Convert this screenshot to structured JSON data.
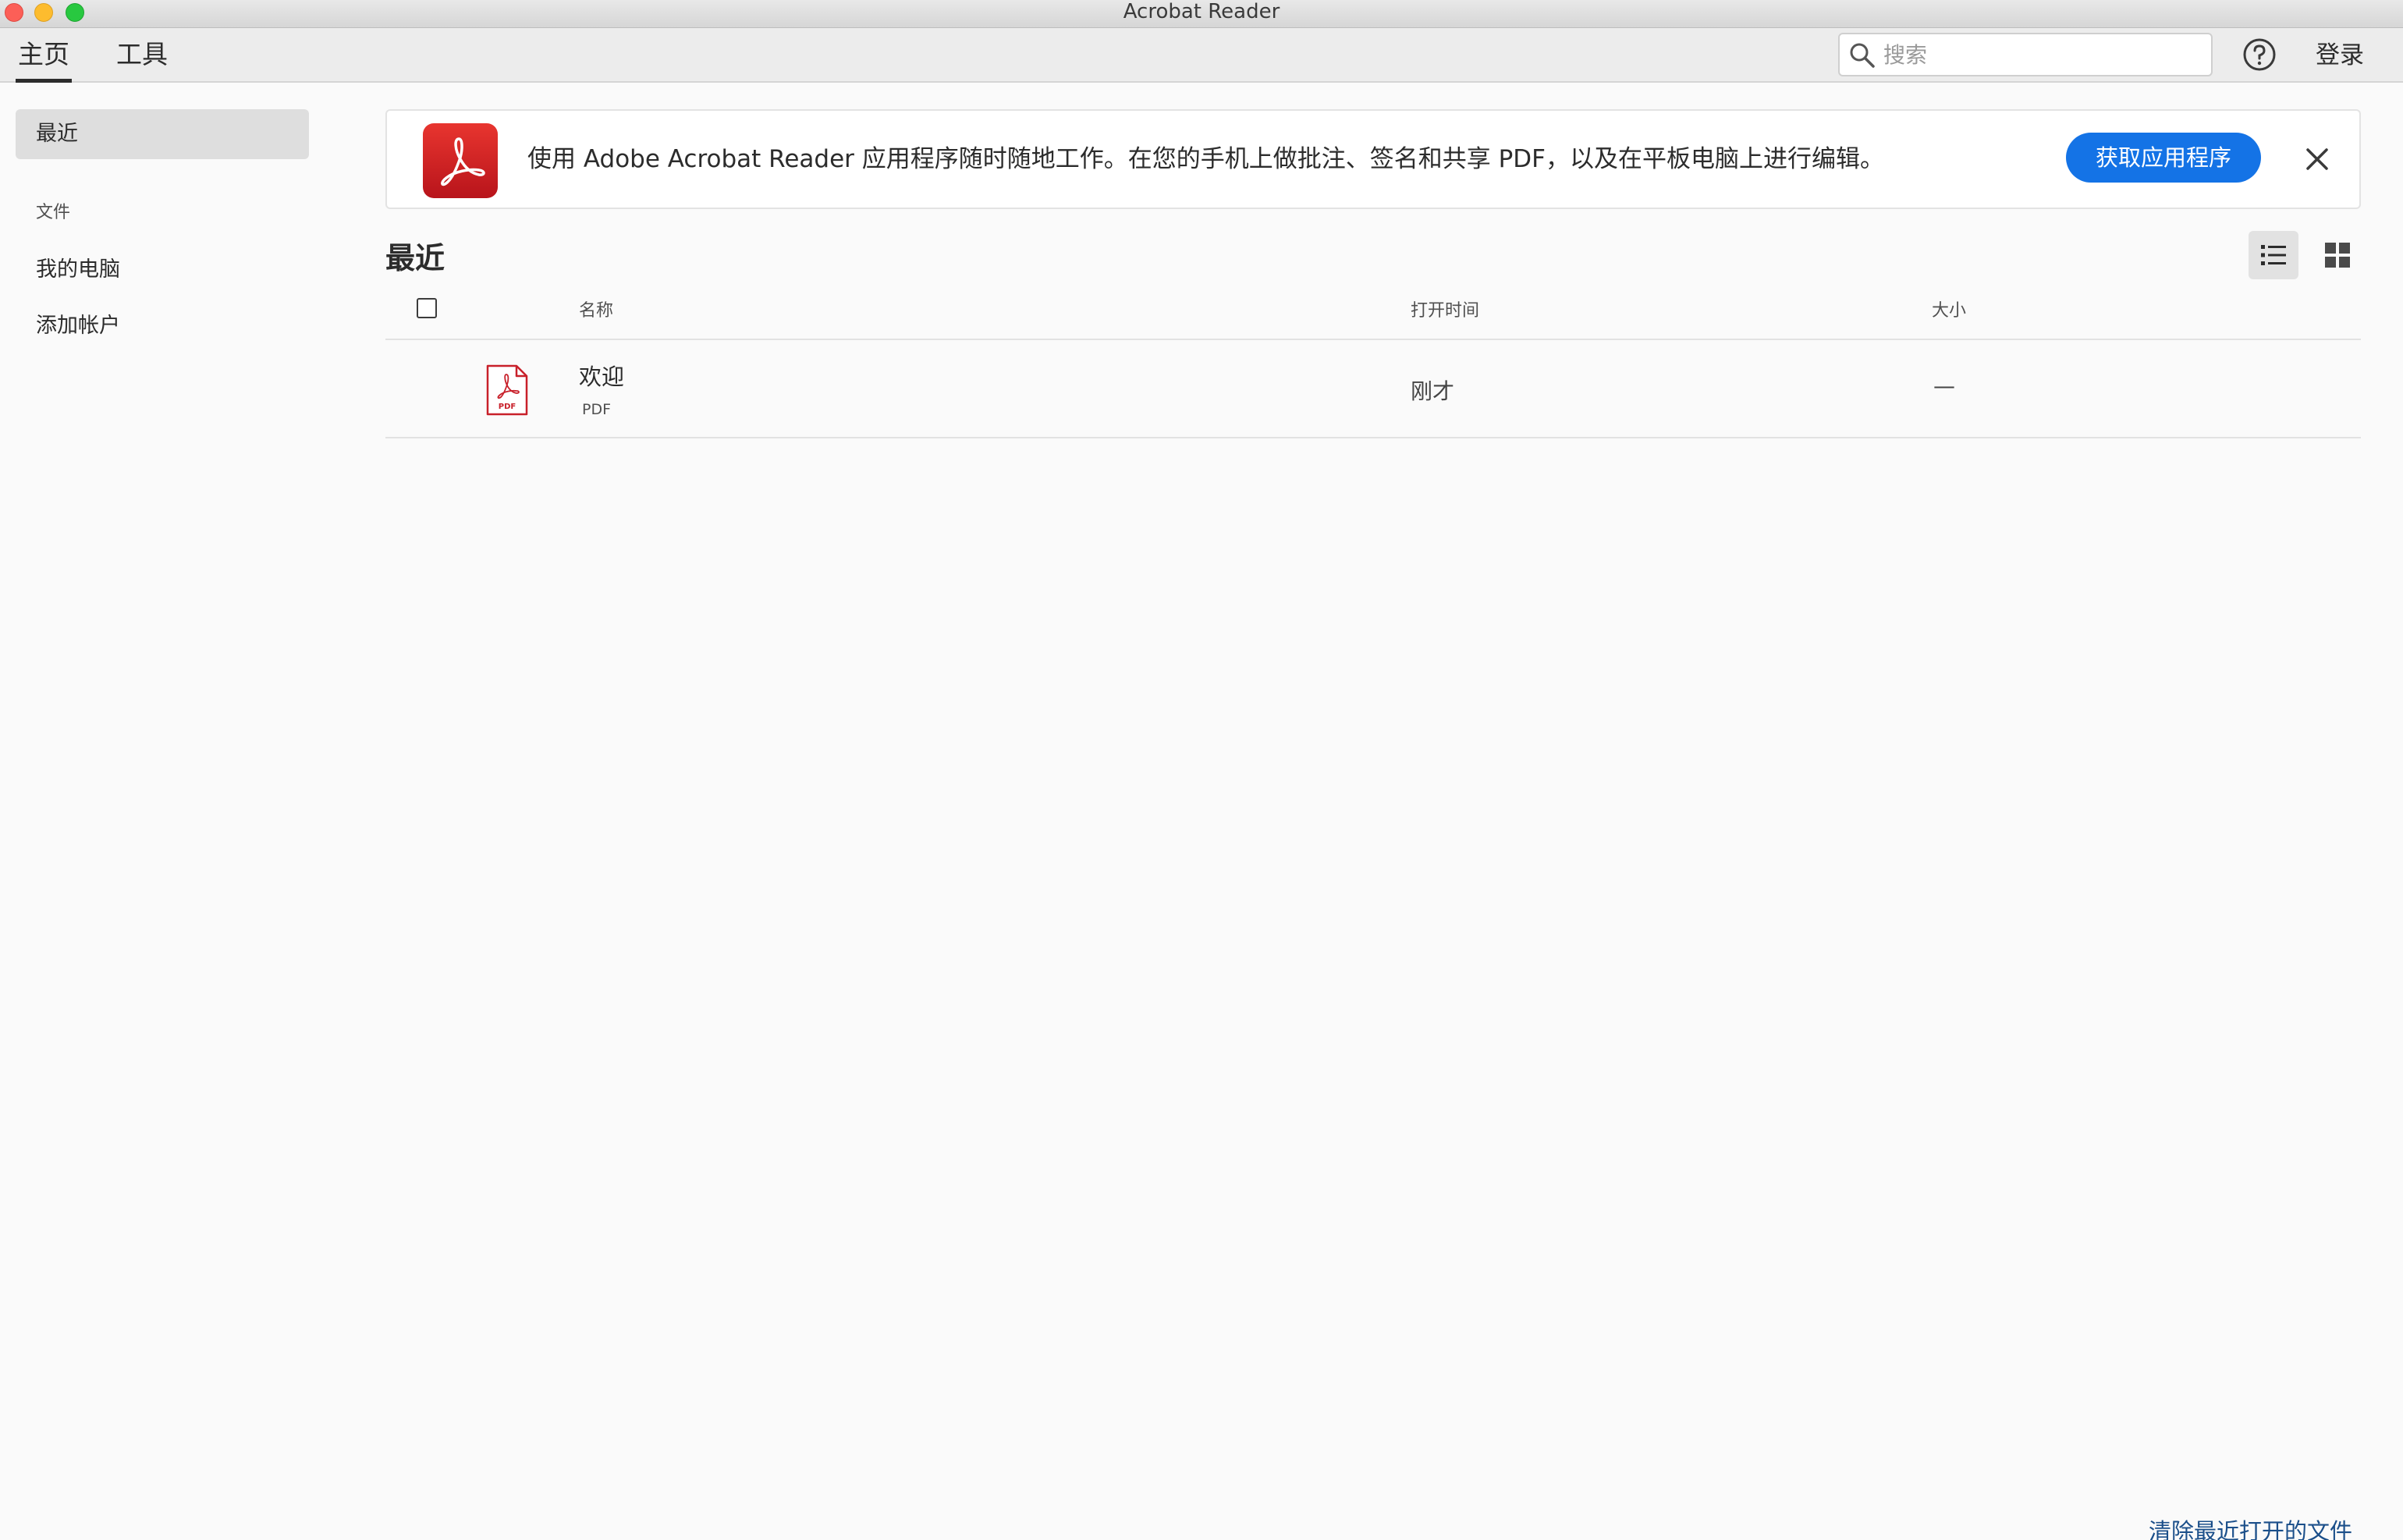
{
  "window": {
    "title": "Acrobat Reader"
  },
  "toolbar": {
    "tabs": [
      {
        "label": "主页",
        "active": true
      },
      {
        "label": "工具",
        "active": false
      }
    ],
    "search": {
      "placeholder": "搜索",
      "value": ""
    },
    "help_icon": "question-circle-icon",
    "signin_label": "登录"
  },
  "sidebar": {
    "recent_label": "最近",
    "section_label": "文件",
    "items": [
      {
        "label": "我的电脑"
      },
      {
        "label": "添加帐户"
      }
    ]
  },
  "banner": {
    "text": "使用 Adobe Acrobat Reader 应用程序随时随地工作。在您的手机上做批注、签名和共享 PDF，以及在平板电脑上进行编辑。",
    "button_label": "获取应用程序",
    "logo_icon": "acrobat-logo-icon",
    "close_icon": "close-icon"
  },
  "recent": {
    "title": "最近",
    "view_modes": [
      "list",
      "grid"
    ],
    "active_view": "list",
    "columns": {
      "name": "名称",
      "opened": "打开时间",
      "size": "大小"
    },
    "rows": [
      {
        "name": "欢迎",
        "type": "PDF",
        "opened": "刚才",
        "size": "—"
      }
    ],
    "clear_label": "清除最近打开的文件"
  },
  "colors": {
    "accent": "#1473e6",
    "acrobat_red": "#d3252a",
    "link": "#1b4f8a"
  }
}
